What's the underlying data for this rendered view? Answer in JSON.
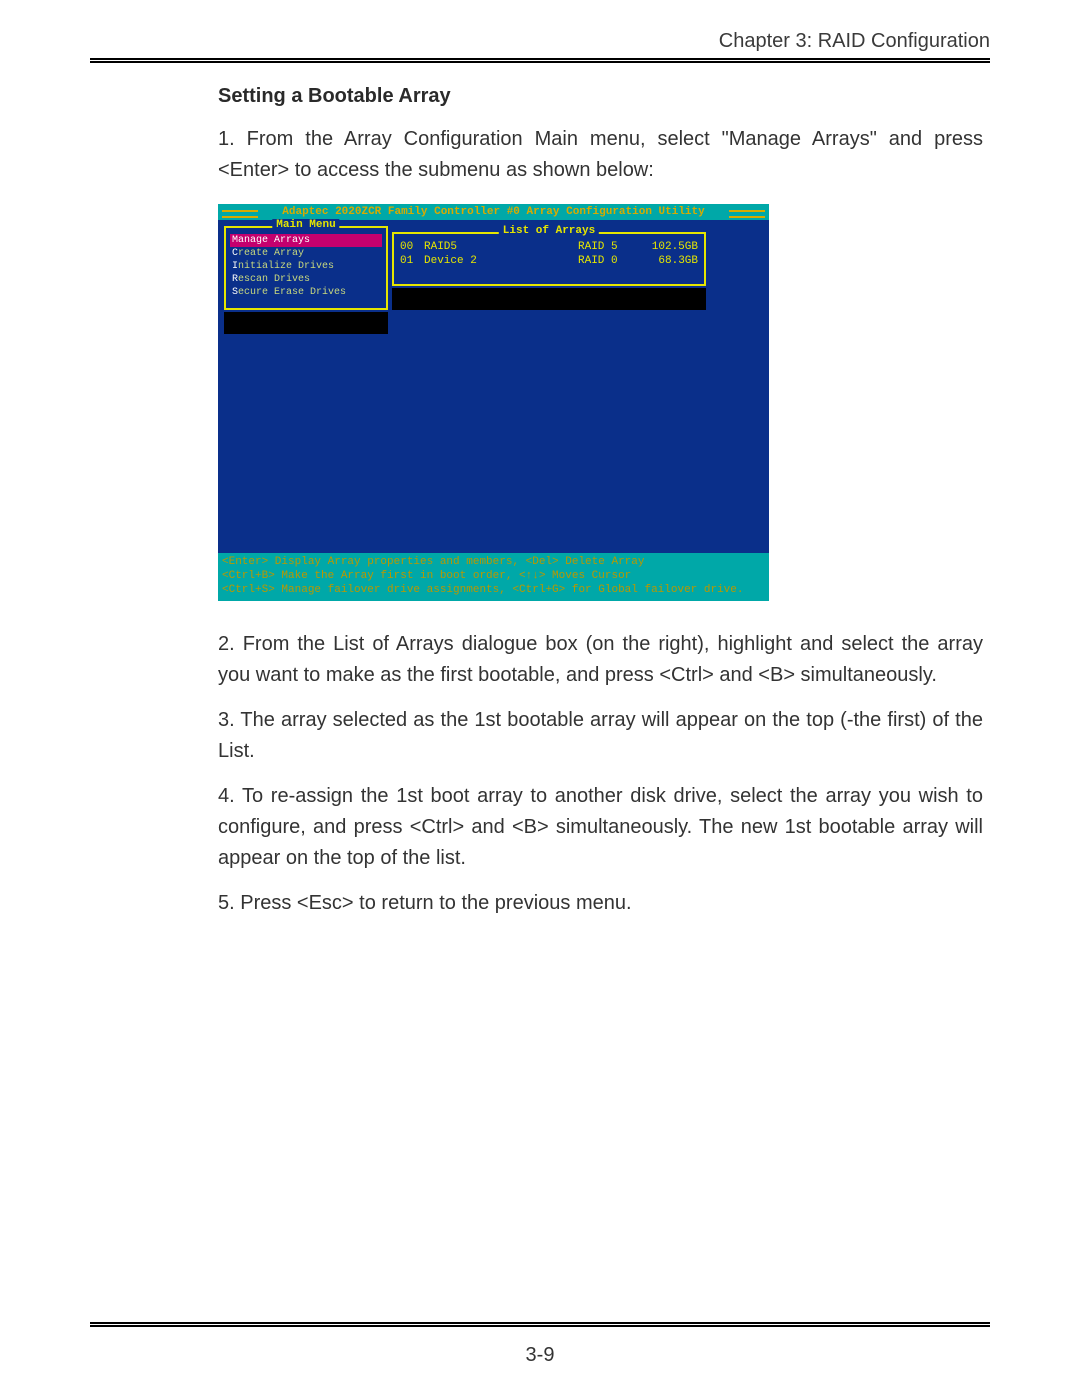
{
  "header": {
    "chapter": "Chapter 3:  RAID Configuration"
  },
  "page_number": "3-9",
  "section_title": "Setting a Bootable Array",
  "paragraphs": {
    "p1": "1. From the Array Configuration Main menu, select \"Manage Arrays\" and  press <Enter> to access the submenu as shown below:",
    "p2": "2. From the List of Arrays dialogue box (on the right), highlight and select the array you want to make as the first bootable, and press <Ctrl> and <B> simultaneously.",
    "p3": "3. The array selected as  the 1st bootable array will appear on the top (-the first) of the List.",
    "p4": "4. To re-assign the 1st boot array to another disk drive, select the array you wish to configure, and press <Ctrl> and  <B> simultaneously.  The new 1st bootable array will appear on the top of the list.",
    "p5": "5. Press <Esc> to return to the previous menu."
  },
  "bios": {
    "title": "Adaptec 2020ZCR Family Controller #0 Array Configuration Utility",
    "main_menu_label": "Main Menu",
    "menu_items": [
      {
        "hotkey": "M",
        "rest": "anage Arrays",
        "selected": true
      },
      {
        "hotkey": "C",
        "rest": "reate Array",
        "selected": false
      },
      {
        "hotkey": "I",
        "rest": "nitialize Drives",
        "selected": false
      },
      {
        "hotkey": "R",
        "rest": "escan Drives",
        "selected": false
      },
      {
        "hotkey": "S",
        "rest": "ecure Erase Drives",
        "selected": false
      }
    ],
    "arrays_label": "List of Arrays",
    "arrays": [
      {
        "id": "00",
        "name": "RAID5",
        "level": "RAID 5",
        "size": "102.5GB"
      },
      {
        "id": "01",
        "name": "Device 2",
        "level": "RAID 0",
        "size": "68.3GB"
      }
    ],
    "footer": {
      "l1": "<Enter> Display Array properties and members, <Del> Delete Array",
      "l2": "<Ctrl+B> Make the Array first in boot order, <↑↓> Moves Cursor",
      "l3": "<Ctrl+S> Manage failover drive assignments, <Ctrl+G> for Global failover drive."
    }
  }
}
